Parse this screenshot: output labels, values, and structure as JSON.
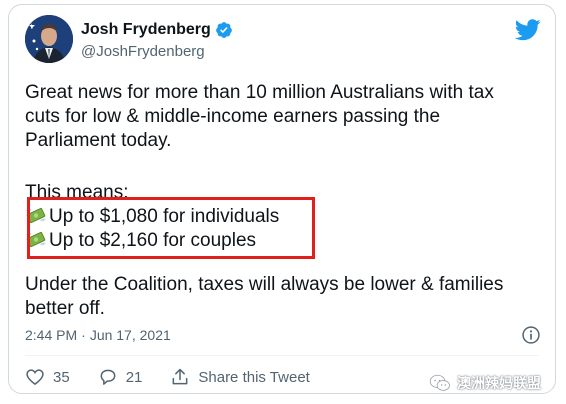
{
  "tweet": {
    "author_name": "Josh Frydenberg",
    "author_handle": "@JoshFrydenberg",
    "paragraph1": [
      "Great news for more than 10 million Australians with tax",
      "cuts for low & middle-income earners passing the",
      "Parliament today."
    ],
    "this_means": "This means:",
    "bullets": [
      "Up to $1,080 for individuals",
      "Up to $2,160 for couples"
    ],
    "paragraph3": [
      "Under the Coalition, taxes will always be lower & families",
      "better off."
    ],
    "time": "2:44 PM",
    "separator": "·",
    "date": "Jun 17, 2021"
  },
  "actions": {
    "likes": "35",
    "replies": "21",
    "share_label": "Share this Tweet"
  },
  "watermark": {
    "text": "澳洲辣妈联盟"
  },
  "colors": {
    "twitter_blue": "#1d9bf0",
    "highlight_red": "#e0201b",
    "text_secondary": "#536471"
  },
  "icons": [
    "verified-badge-icon",
    "twitter-bird-icon",
    "money-wings-icon",
    "info-icon",
    "heart-icon",
    "reply-icon",
    "share-icon",
    "wechat-icon"
  ]
}
